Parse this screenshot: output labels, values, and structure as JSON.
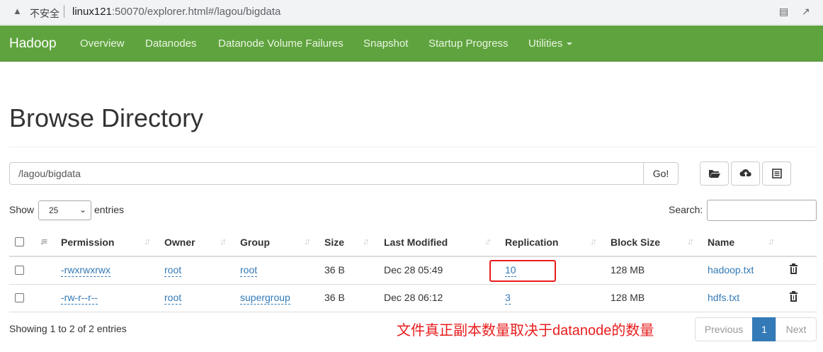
{
  "browser": {
    "insecure_label": "不安全",
    "url_host": "linux121",
    "url_rest": ":50070/explorer.html#/lagou/bigdata"
  },
  "nav": {
    "brand": "Hadoop",
    "items": [
      "Overview",
      "Datanodes",
      "Datanode Volume Failures",
      "Snapshot",
      "Startup Progress",
      "Utilities"
    ]
  },
  "page_title": "Browse Directory",
  "path": {
    "value": "/lagou/bigdata",
    "go_label": "Go!"
  },
  "toolbar": {
    "icons": [
      "folder-open-icon",
      "cloud-upload-icon",
      "list-alt-icon"
    ]
  },
  "length_menu": {
    "show_label": "Show",
    "selected": "25",
    "entries_label": "entries"
  },
  "search": {
    "label": "Search:",
    "value": ""
  },
  "table": {
    "columns": [
      "Permission",
      "Owner",
      "Group",
      "Size",
      "Last Modified",
      "Replication",
      "Block Size",
      "Name"
    ],
    "rows": [
      {
        "permission": "-rwxrwxrwx",
        "owner": "root",
        "group": "root",
        "size": "36 B",
        "modified": "Dec 28 05:49",
        "replication": "10",
        "block_size": "128 MB",
        "name": "hadoop.txt"
      },
      {
        "permission": "-rw-r--r--",
        "owner": "root",
        "group": "supergroup",
        "size": "36 B",
        "modified": "Dec 28 06:12",
        "replication": "3",
        "block_size": "128 MB",
        "name": "hdfs.txt"
      }
    ]
  },
  "info": "Showing 1 to 2 of 2 entries",
  "annotation": "文件真正副本数量取决于datanode的数量",
  "pagination": {
    "previous": "Previous",
    "current": "1",
    "next": "Next"
  },
  "colors": {
    "navbar": "#5fa33e",
    "link": "#337ab7",
    "annotation": "#e81d1d"
  }
}
